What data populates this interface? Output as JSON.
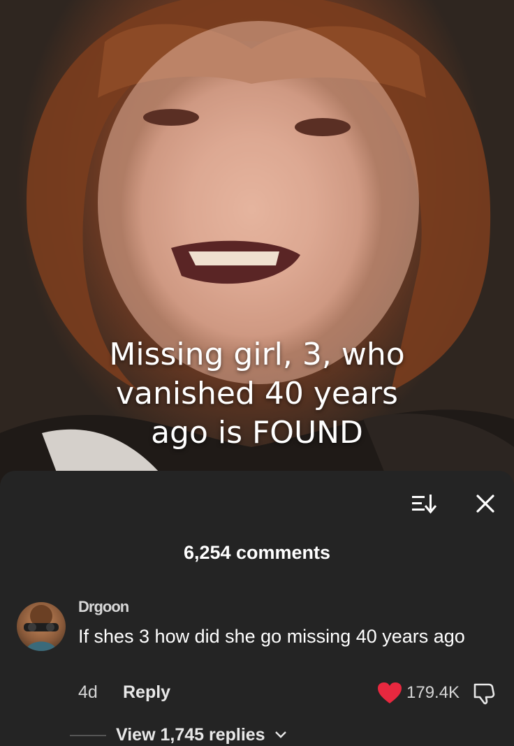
{
  "post": {
    "headline_line1": "Missing girl, 3, who",
    "headline_line2": "vanished 40 years",
    "headline_line3": "ago is FOUND"
  },
  "comments_panel": {
    "count_label": "6,254 comments",
    "sort_icon": "sort-icon",
    "close_icon": "close-icon"
  },
  "comment": {
    "username": "Drgoon",
    "text": "If shes 3 how did she go missing 40 years ago",
    "age": "4d",
    "reply_label": "Reply",
    "like_count": "179.4K",
    "liked": true,
    "like_color": "#e8283f",
    "view_replies_label": "View 1,745 replies"
  }
}
